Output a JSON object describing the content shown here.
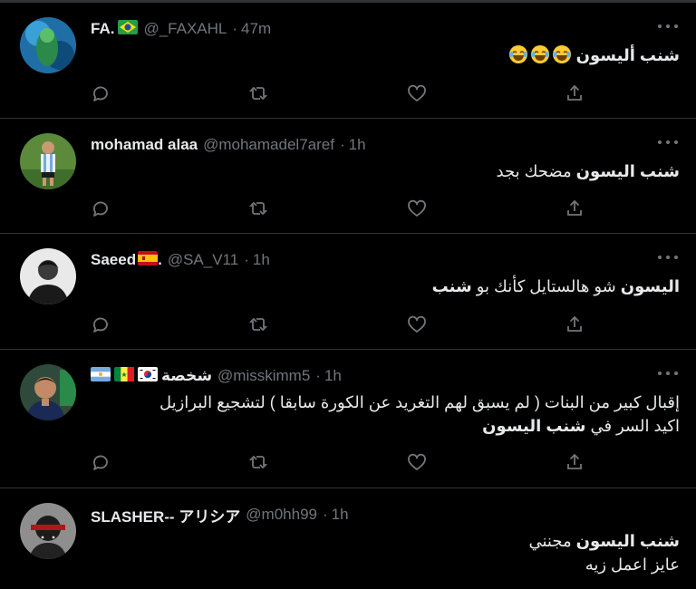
{
  "tweets": [
    {
      "name": "FA.",
      "flags": [
        "brazil"
      ],
      "handle": "@_FAXAHL",
      "time": "47m",
      "lines": [
        {
          "bold": "شنب أليسون",
          "rest": ""
        }
      ],
      "emoji_count": 3,
      "emoji": "face-with-tears-of-joy"
    },
    {
      "name": "mohamad alaa",
      "flags": [],
      "handle": "@mohamadel7aref",
      "time": "1h",
      "lines": [
        {
          "bold": "شنب اليسون",
          "rest": " مضحك بجد"
        }
      ]
    },
    {
      "name": "Saeed",
      "name_suffix": ".",
      "flags": [
        "spain"
      ],
      "handle": "@SA_V11",
      "time": "1h",
      "lines": [
        {
          "bold": "اليسون",
          "rest": " شو هالستايل كأنك بو ",
          "bold2": "شنب"
        }
      ]
    },
    {
      "name": "شخصة",
      "flags": [
        "argentina",
        "senegal",
        "south-korea"
      ],
      "handle": "@misskimm5",
      "time": "1h",
      "lines": [
        {
          "bold": "",
          "rest": "إقبال كبير من البنات ( لم يسبق لهم التغريد عن الكورة سابقا ) لتشجيع البرازيل"
        },
        {
          "bold": "",
          "rest": "اكيد السر في ",
          "bold2": "شنب اليسون"
        }
      ]
    },
    {
      "name": "SLASHER-- アリシア",
      "flags": [],
      "handle": "@m0hh99",
      "time": "1h",
      "lines": [
        {
          "bold": "شنب اليسون",
          "rest": " مجنني"
        },
        {
          "bold": "",
          "rest": "عايز اعمل زيه"
        }
      ]
    }
  ],
  "actions": [
    "reply-icon",
    "retweet-icon",
    "like-icon",
    "share-icon"
  ],
  "colors": {
    "background": "#000000",
    "divider": "#2f3336",
    "text": "#e7e9ea",
    "muted": "#71767b"
  }
}
